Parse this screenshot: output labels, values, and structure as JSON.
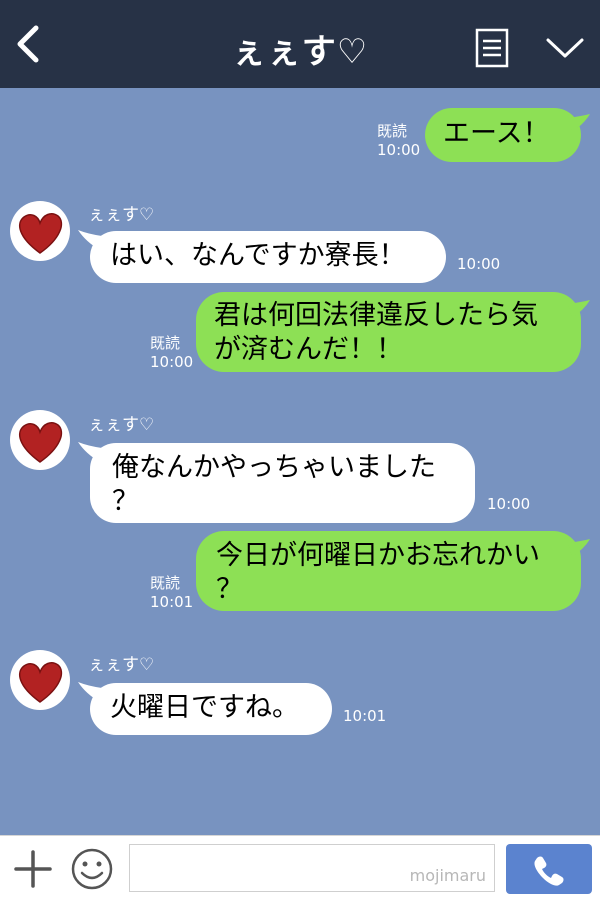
{
  "header": {
    "title": "ぇぇす♡"
  },
  "messages": [
    {
      "from": "me",
      "text": "エース！",
      "read": "既読",
      "time": "10:00"
    },
    {
      "from": "them",
      "sender": "ぇぇす♡",
      "text": "はい、なんですか寮長！",
      "time": "10:00"
    },
    {
      "from": "me",
      "lines": [
        "君は何回法律違反したら気",
        "が済むんだ！！"
      ],
      "read": "既読",
      "time": "10:00"
    },
    {
      "from": "them",
      "sender": "ぇぇす♡",
      "lines": [
        "俺なんかやっちゃいました",
        "？"
      ],
      "time": "10:00"
    },
    {
      "from": "me",
      "lines": [
        "今日が何曜日かお忘れかい",
        "？"
      ],
      "read": "既読",
      "time": "10:01"
    },
    {
      "from": "them",
      "sender": "ぇぇす♡",
      "text": "火曜日ですね。",
      "time": "10:01"
    }
  ],
  "footer": {
    "watermark": "mojimaru"
  },
  "colors": {
    "background": "#7893c0",
    "header": "#273246",
    "my_bubble": "#8de055",
    "their_bubble": "#ffffff",
    "send_button": "#5b83cf",
    "avatar_heart": "#b22222"
  },
  "icons": {
    "back": "chevron-left-icon",
    "menu": "document-menu-icon",
    "expand": "chevron-down-icon",
    "plus": "plus-icon",
    "emoji": "smiley-icon",
    "send": "phone-icon",
    "avatar": "heart-icon"
  }
}
